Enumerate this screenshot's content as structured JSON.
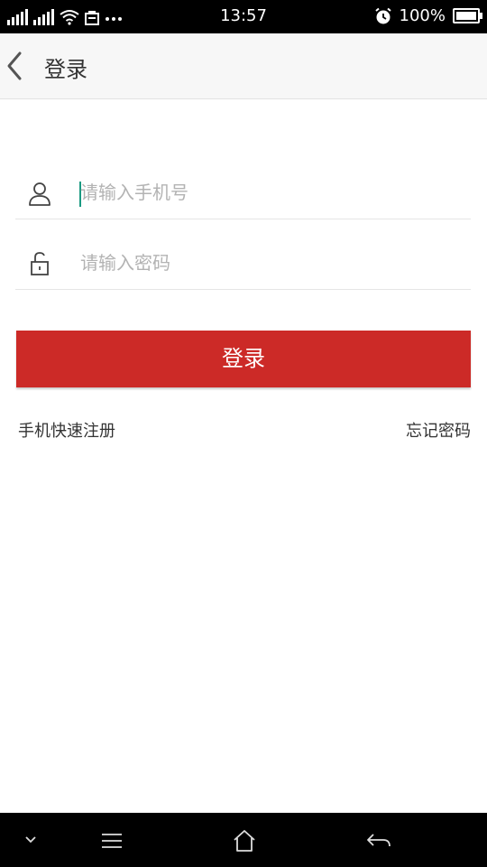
{
  "status_bar": {
    "time": "13:57",
    "battery": "100%",
    "icons": [
      "signal-icon",
      "signal-icon",
      "wifi-icon",
      "notification-icon",
      "more-dots-icon",
      "alarm-icon",
      "battery-icon"
    ]
  },
  "header": {
    "title": "登录",
    "back_icon": "chevron-left-icon"
  },
  "form": {
    "phone_placeholder": "请输入手机号",
    "phone_value": "",
    "password_placeholder": "请输入密码",
    "password_value": "",
    "login_label": "登录",
    "accent_color": "#cc2a27",
    "cursor_color": "#1a9a82"
  },
  "links": {
    "register": "手机快速注册",
    "forgot": "忘记密码"
  },
  "nav_bar": {
    "icons": [
      "chevron-down-icon",
      "menu-icon",
      "home-icon",
      "back-arrow-icon"
    ]
  }
}
